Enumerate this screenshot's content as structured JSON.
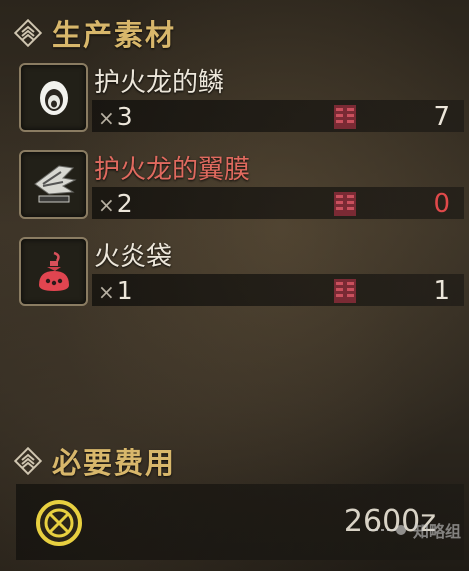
{
  "materials_header": {
    "title": "生产素材",
    "icon": "diamond-emblem-icon"
  },
  "materials": [
    {
      "name": "护火龙的鳞",
      "qty_prefix": "×",
      "qty": "3",
      "owned": "7",
      "name_color": "#ece6da",
      "owned_color": "#ece6da",
      "icon": "scale-icon"
    },
    {
      "name": "护火龙的翼膜",
      "qty_prefix": "×",
      "qty": "2",
      "owned": "0",
      "name_color": "#e06a5f",
      "owned_color": "#e0494a",
      "icon": "wing-membrane-icon"
    },
    {
      "name": "火炎袋",
      "qty_prefix": "×",
      "qty": "1",
      "owned": "1",
      "name_color": "#ece6da",
      "owned_color": "#ece6da",
      "icon": "flame-sac-icon"
    }
  ],
  "cost_header": {
    "title": "必要费用",
    "icon": "diamond-emblem-icon"
  },
  "cost": {
    "value": "2600z",
    "icon": "zenny-coin-icon"
  },
  "watermark": {
    "text": "知略组",
    "icon": "shuttlecock-logo-icon"
  }
}
